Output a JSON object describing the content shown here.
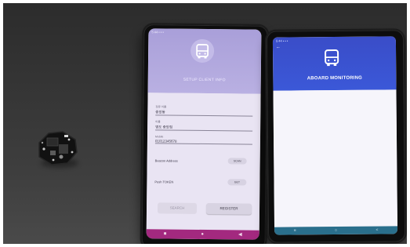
{
  "scene": {
    "objects": [
      "circuit-board",
      "android-phone-register-app",
      "android-phone-monitor-app"
    ]
  },
  "left_phone": {
    "app": {
      "title": "SETUP CLIENT INFO",
      "fields": [
        {
          "label": "정류 이름",
          "value": "중앙동"
        },
        {
          "label": "이름",
          "value": "영도 중앙점"
        },
        {
          "label": "Mobile",
          "value": "01012345678"
        }
      ],
      "beacon_label": "Beacon Address",
      "beacon_button": "SCAN",
      "push_label": "Push TOKEN",
      "push_button": "GET",
      "search_button": "SEARCH",
      "register_button": "REGISTER",
      "nav": [
        "■",
        "●",
        "◀"
      ]
    }
  },
  "right_phone": {
    "app": {
      "title": "ABOARD MONITORING",
      "nav": [
        "≡",
        "○",
        "<"
      ]
    }
  },
  "colors": {
    "left_header": "#b0a6de",
    "left_nav": "#a3297f",
    "right_header": "#3b52d0",
    "right_nav": "#2a6f8c"
  }
}
